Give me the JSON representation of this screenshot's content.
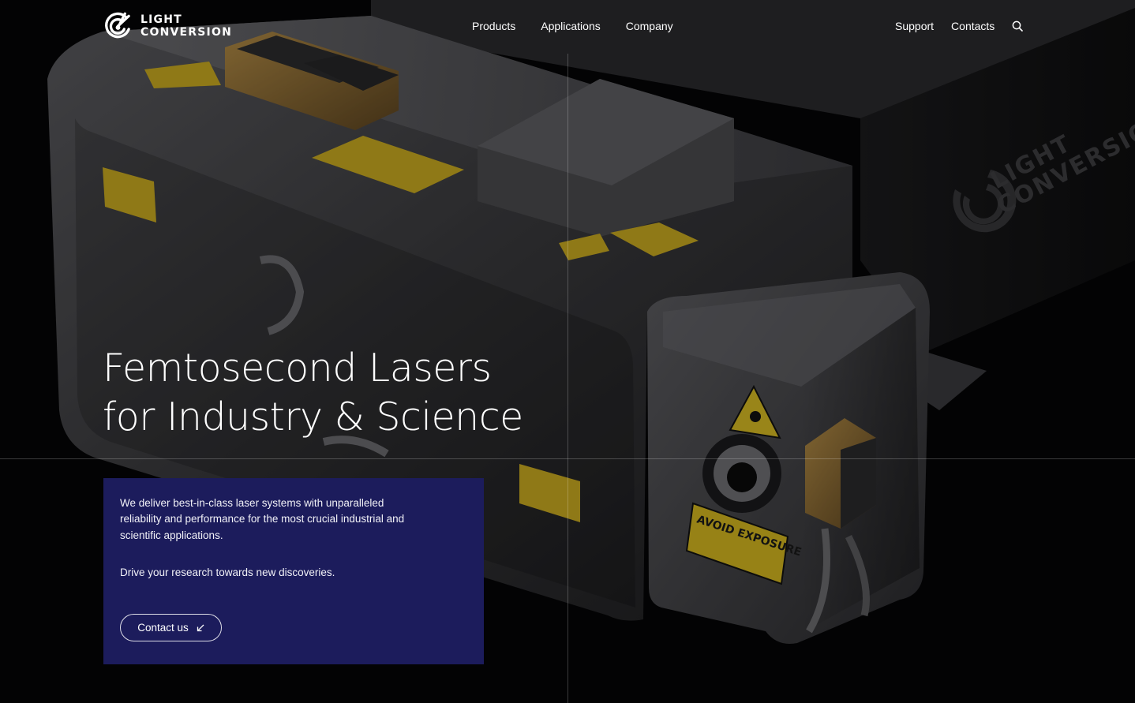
{
  "brand": {
    "line1": "LIGHT",
    "line2": "CONVERSION"
  },
  "nav": {
    "main": [
      "Products",
      "Applications",
      "Company"
    ],
    "secondary": [
      "Support",
      "Contacts"
    ],
    "search_icon": "search-icon"
  },
  "hero": {
    "title_line1": "Femtosecond Lasers",
    "title_line2": "for Industry & Science",
    "intro": "We deliver best-in-class laser systems with unparalleled reliability and performance for the most crucial industrial and scientific applications.",
    "tagline": "Drive your research towards new discoveries.",
    "cta_label": "Contact us",
    "cta_icon": "arrow-down-left-icon"
  },
  "product_labels": {
    "warning": "AVOID EXPOSURE",
    "engraving_line1": "LIGHT",
    "engraving_line2": "CONVERSION"
  },
  "colors": {
    "background": "#050506",
    "card": "#1c1c5c",
    "text": "#ffffff",
    "label_yellow": "#d9b926"
  }
}
